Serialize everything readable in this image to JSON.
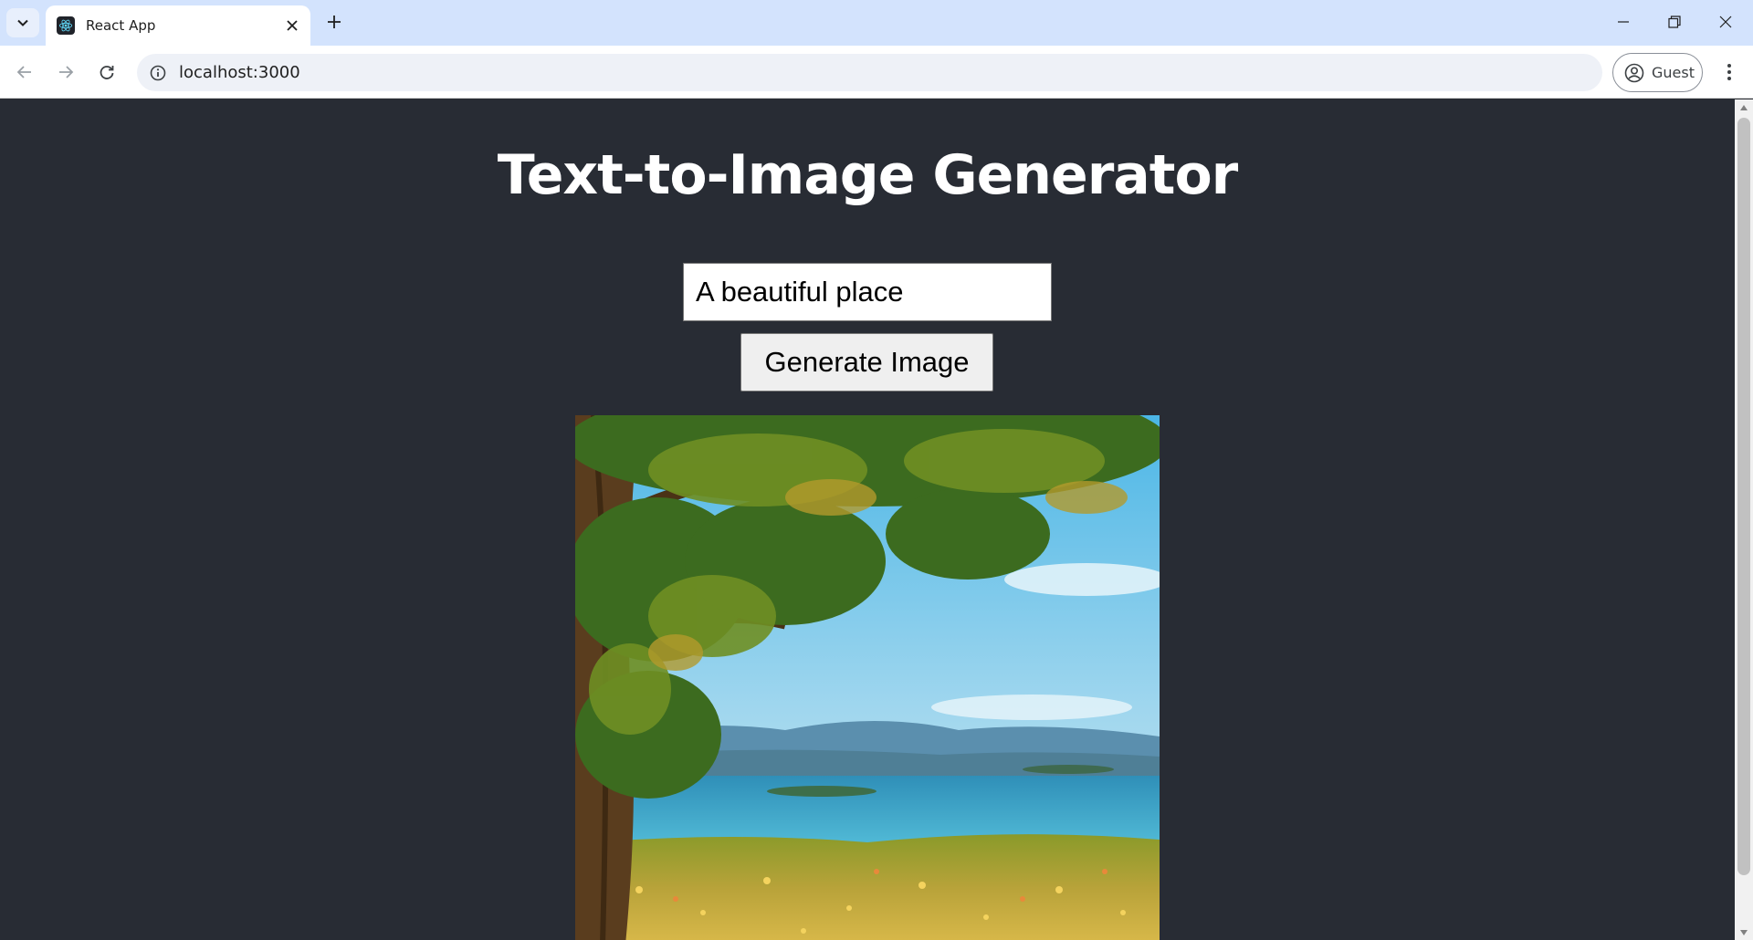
{
  "browser": {
    "tab_title": "React App",
    "url": "localhost:3000",
    "profile_label": "Guest"
  },
  "app": {
    "title": "Text-to-Image Generator",
    "prompt_value": "A beautiful place",
    "generate_label": "Generate Image"
  },
  "colors": {
    "page_background": "#282c34",
    "tabstrip": "#d3e3fd",
    "omnibox": "#eef1f7"
  },
  "icons": {
    "tab_search": "chevron-down-icon",
    "favicon": "react-logo-icon",
    "tab_close": "close-icon",
    "new_tab": "plus-icon",
    "back": "arrow-left-icon",
    "forward": "arrow-right-icon",
    "reload": "reload-icon",
    "site_info": "info-icon",
    "profile": "account-circle-icon",
    "menu": "more-vert-icon"
  }
}
